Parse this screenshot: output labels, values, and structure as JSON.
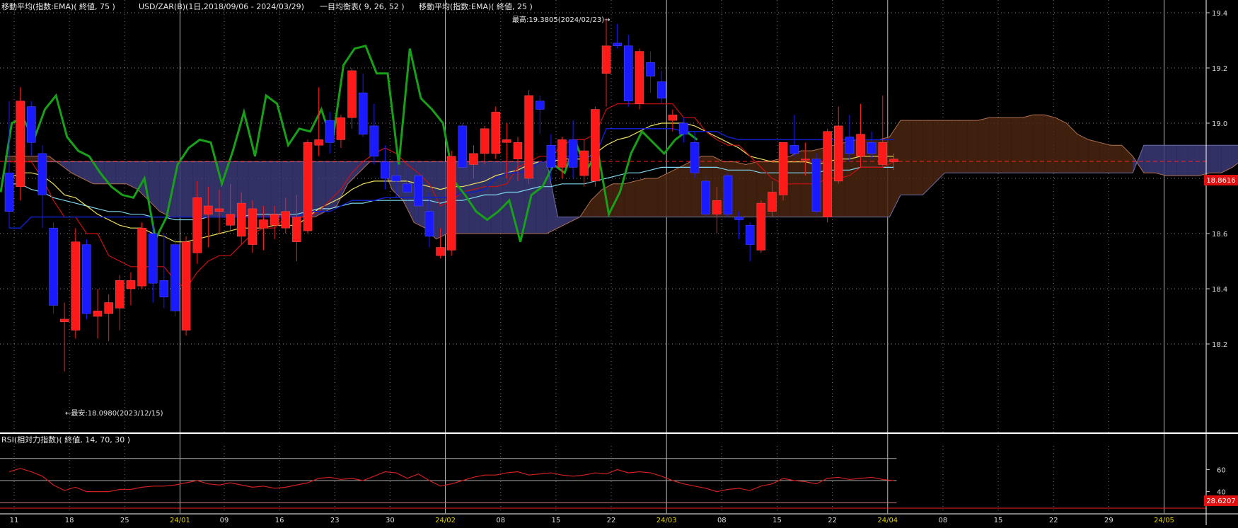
{
  "header": {
    "ema75_label": "移動平均(指数:EMA)( 終値, 75 )",
    "symbol_label": "USD/ZAR(B)(1日,2018/09/06 - 2024/03/29)",
    "ichimoku_label": "一目均衡表( 9, 26, 52 )",
    "ema25_label": "移動平均(指数:EMA)( 終値, 25 )"
  },
  "annotations": {
    "high": "最高:19.3805(2024/02/23)→",
    "low": "←最安:18.0980(2023/12/15)",
    "last_price": "18.8616",
    "rsi_last": "28.6207"
  },
  "rsi_panel": {
    "title": "RSI(相対力指数)( 終値, 14, 70, 30 )",
    "y_ticks": [
      "60",
      "40"
    ]
  },
  "colors": {
    "up_candle": "#ff1a1a",
    "down_candle": "#1a1aff",
    "ema75": "#7fd8f0",
    "ema25": "#f0e060",
    "tenkan": "#cc1010",
    "kijun": "#1020c8",
    "chikou": "#18a018",
    "kumo_bull": "#3a3a78",
    "kumo_bear": "#4a2410",
    "rsi_line": "#d02020",
    "price_line": "#ff2020"
  },
  "chart_data": [
    {
      "type": "candlestick",
      "ylim": [
        18.0,
        19.45
      ],
      "y_ticks": [
        "19.4",
        "19.2",
        "19.0",
        "18.8",
        "18.6",
        "18.4",
        "18.2"
      ],
      "x_ticks": [
        "11",
        "18",
        "25",
        "24/01",
        "09",
        "16",
        "23",
        "30",
        "24/02",
        "08",
        "15",
        "22",
        "24/03",
        "08",
        "15",
        "22",
        "24/04",
        "08",
        "15",
        "22",
        "29",
        "24/05"
      ],
      "bars": [
        [
          18.82,
          19.08,
          18.62,
          18.68
        ],
        [
          18.77,
          19.13,
          18.72,
          19.08
        ],
        [
          19.06,
          19.08,
          18.88,
          18.93
        ],
        [
          18.89,
          18.92,
          18.62,
          18.74
        ],
        [
          18.62,
          18.64,
          18.31,
          18.34
        ],
        [
          18.28,
          18.35,
          18.1,
          18.29
        ],
        [
          18.25,
          18.62,
          18.22,
          18.57
        ],
        [
          18.56,
          18.58,
          18.29,
          18.31
        ],
        [
          18.3,
          18.4,
          18.22,
          18.32
        ],
        [
          18.31,
          18.38,
          18.21,
          18.35
        ],
        [
          18.33,
          18.45,
          18.25,
          18.43
        ],
        [
          18.4,
          18.46,
          18.34,
          18.43
        ],
        [
          18.41,
          18.64,
          18.4,
          18.62
        ],
        [
          18.6,
          18.63,
          18.35,
          18.42
        ],
        [
          18.43,
          18.6,
          18.33,
          18.37
        ],
        [
          18.56,
          18.58,
          18.3,
          18.32
        ],
        [
          18.25,
          18.59,
          18.23,
          18.57
        ],
        [
          18.53,
          18.79,
          18.49,
          18.73
        ],
        [
          18.67,
          18.77,
          18.55,
          18.7
        ],
        [
          18.68,
          18.76,
          18.6,
          18.69
        ],
        [
          18.63,
          18.78,
          18.61,
          18.67
        ],
        [
          18.59,
          18.75,
          18.56,
          18.71
        ],
        [
          18.56,
          18.72,
          18.53,
          18.69
        ],
        [
          18.62,
          18.7,
          18.54,
          18.65
        ],
        [
          18.63,
          18.7,
          18.58,
          18.67
        ],
        [
          18.62,
          18.73,
          18.6,
          18.68
        ],
        [
          18.57,
          18.74,
          18.5,
          18.66
        ],
        [
          18.61,
          18.94,
          18.6,
          18.93
        ],
        [
          18.92,
          19.13,
          18.88,
          18.94
        ],
        [
          19.01,
          19.04,
          18.89,
          18.93
        ],
        [
          18.94,
          19.03,
          18.91,
          19.02
        ],
        [
          19.02,
          19.2,
          18.98,
          19.19
        ],
        [
          19.11,
          19.18,
          18.95,
          18.96
        ],
        [
          18.99,
          19.07,
          18.85,
          18.88
        ],
        [
          18.86,
          18.92,
          18.76,
          18.8
        ],
        [
          18.81,
          18.86,
          18.73,
          18.79
        ],
        [
          18.78,
          18.84,
          18.72,
          18.75
        ],
        [
          18.81,
          18.83,
          18.64,
          18.7
        ],
        [
          18.68,
          18.75,
          18.55,
          18.59
        ],
        [
          18.52,
          18.62,
          18.51,
          18.55
        ],
        [
          18.54,
          18.9,
          18.52,
          18.88
        ],
        [
          18.99,
          19.0,
          18.83,
          18.84
        ],
        [
          18.85,
          18.92,
          18.8,
          18.89
        ],
        [
          18.89,
          18.99,
          18.85,
          18.98
        ],
        [
          18.89,
          19.06,
          18.87,
          19.04
        ],
        [
          18.93,
          19.0,
          18.8,
          18.94
        ],
        [
          18.87,
          18.95,
          18.79,
          18.93
        ],
        [
          18.8,
          19.12,
          18.78,
          19.1
        ],
        [
          19.08,
          19.1,
          18.96,
          19.05
        ],
        [
          18.92,
          18.96,
          18.79,
          18.84
        ],
        [
          18.84,
          18.95,
          18.8,
          18.94
        ],
        [
          18.94,
          19.01,
          18.8,
          18.84
        ],
        [
          18.81,
          18.94,
          18.77,
          18.9
        ],
        [
          18.79,
          19.06,
          18.77,
          19.05
        ],
        [
          19.18,
          19.38,
          19.06,
          19.28
        ],
        [
          19.29,
          19.36,
          19.27,
          19.28
        ],
        [
          19.28,
          19.32,
          19.06,
          19.08
        ],
        [
          19.07,
          19.27,
          19.05,
          19.26
        ],
        [
          19.22,
          19.26,
          19.11,
          19.17
        ],
        [
          19.15,
          19.19,
          19.07,
          19.09
        ],
        [
          19.01,
          19.05,
          18.97,
          19.03
        ],
        [
          19.0,
          19.02,
          18.93,
          18.96
        ],
        [
          18.93,
          18.97,
          18.8,
          18.82
        ],
        [
          18.79,
          18.81,
          18.66,
          18.67
        ],
        [
          18.67,
          18.77,
          18.6,
          18.72
        ],
        [
          18.81,
          18.82,
          18.66,
          18.67
        ],
        [
          18.66,
          18.68,
          18.58,
          18.65
        ],
        [
          18.63,
          18.64,
          18.5,
          18.56
        ],
        [
          18.54,
          18.72,
          18.53,
          18.71
        ],
        [
          18.68,
          18.79,
          18.66,
          18.75
        ],
        [
          18.74,
          18.93,
          18.72,
          18.93
        ],
        [
          18.92,
          19.03,
          18.88,
          18.89
        ],
        [
          18.87,
          18.93,
          18.81,
          18.87
        ],
        [
          18.87,
          18.89,
          18.67,
          18.68
        ],
        [
          18.66,
          18.98,
          18.64,
          18.97
        ],
        [
          18.79,
          19.06,
          18.78,
          18.99
        ],
        [
          18.95,
          19.03,
          18.86,
          18.89
        ],
        [
          18.88,
          19.07,
          18.84,
          18.96
        ],
        [
          18.93,
          18.97,
          18.87,
          18.89
        ],
        [
          18.85,
          19.1,
          18.84,
          18.93
        ],
        [
          18.86,
          18.89,
          18.83,
          18.87
        ]
      ],
      "kumo_span_a": [
        18.88,
        18.88,
        18.88,
        18.88,
        18.88,
        18.85,
        18.82,
        18.8,
        18.78,
        18.78,
        18.78,
        18.78,
        18.76,
        18.72,
        18.68,
        18.66,
        18.66,
        18.66,
        18.66,
        18.66,
        18.66,
        18.66,
        18.66,
        18.66,
        18.66,
        18.66,
        18.66,
        18.66,
        18.66,
        18.68,
        18.7,
        18.78,
        18.82,
        18.86,
        18.86,
        18.76,
        18.72,
        18.64,
        18.62,
        18.58,
        18.6,
        18.6,
        18.6,
        18.6,
        18.6,
        18.6,
        18.6,
        18.6,
        18.6,
        18.6,
        18.62,
        18.64,
        18.66,
        18.72,
        18.76,
        18.78,
        18.78,
        18.79,
        18.8,
        18.8,
        18.82,
        18.84,
        18.86,
        18.88,
        18.88,
        18.86,
        18.86,
        18.85,
        18.86,
        18.86,
        18.87,
        18.88,
        18.9,
        18.9,
        18.91,
        18.92,
        18.93,
        18.94,
        18.94,
        18.94,
        18.95,
        19.01,
        19.01,
        19.01,
        19.01,
        19.01,
        19.01,
        19.01,
        19.01,
        19.02,
        19.02,
        19.02,
        19.02,
        19.03,
        19.03,
        19.02,
        19.0,
        18.96,
        18.94,
        18.93,
        18.92,
        18.92,
        18.88,
        18.82,
        18.82,
        18.81,
        18.81,
        18.81,
        18.81,
        18.82,
        18.82,
        18.84,
        18.87,
        18.89,
        18.9,
        18.9
      ],
      "kumo_span_b": [
        18.86,
        18.86,
        18.86,
        18.86,
        18.86,
        18.86,
        18.86,
        18.86,
        18.86,
        18.86,
        18.86,
        18.86,
        18.86,
        18.86,
        18.86,
        18.86,
        18.86,
        18.86,
        18.86,
        18.86,
        18.86,
        18.86,
        18.86,
        18.86,
        18.86,
        18.86,
        18.86,
        18.86,
        18.86,
        18.86,
        18.86,
        18.86,
        18.86,
        18.86,
        18.86,
        18.86,
        18.86,
        18.86,
        18.86,
        18.86,
        18.86,
        18.86,
        18.86,
        18.86,
        18.86,
        18.86,
        18.86,
        18.86,
        18.86,
        18.86,
        18.66,
        18.66,
        18.66,
        18.66,
        18.66,
        18.66,
        18.66,
        18.66,
        18.66,
        18.66,
        18.66,
        18.66,
        18.66,
        18.66,
        18.66,
        18.66,
        18.66,
        18.66,
        18.66,
        18.66,
        18.66,
        18.66,
        18.66,
        18.66,
        18.66,
        18.66,
        18.66,
        18.66,
        18.66,
        18.66,
        18.66,
        18.74,
        18.74,
        18.74,
        18.78,
        18.82,
        18.82,
        18.82,
        18.82,
        18.82,
        18.82,
        18.82,
        18.82,
        18.82,
        18.82,
        18.82,
        18.82,
        18.82,
        18.82,
        18.82,
        18.82,
        18.82,
        18.82,
        18.92,
        18.92,
        18.92,
        18.92,
        18.92,
        18.92,
        18.92,
        18.92,
        18.92,
        18.92,
        18.92,
        18.92,
        18.92
      ],
      "ema75": [
        18.78,
        18.78,
        18.76,
        18.75,
        18.73,
        18.72,
        18.71,
        18.7,
        18.69,
        18.68,
        18.68,
        18.67,
        18.67,
        18.66,
        18.66,
        18.65,
        18.65,
        18.65,
        18.66,
        18.66,
        18.66,
        18.66,
        18.67,
        18.67,
        18.67,
        18.67,
        18.67,
        18.68,
        18.69,
        18.69,
        18.7,
        18.71,
        18.71,
        18.72,
        18.72,
        18.72,
        18.72,
        18.72,
        18.72,
        18.71,
        18.72,
        18.72,
        18.73,
        18.74,
        18.74,
        18.75,
        18.75,
        18.76,
        18.77,
        18.77,
        18.78,
        18.78,
        18.78,
        18.79,
        18.8,
        18.81,
        18.82,
        18.82,
        18.83,
        18.84,
        18.84,
        18.84,
        18.84,
        18.84,
        18.84,
        18.83,
        18.83,
        18.83,
        18.82,
        18.82,
        18.82,
        18.82,
        18.82,
        18.82,
        18.83,
        18.83,
        18.83,
        18.84,
        18.84,
        18.84,
        18.84
      ],
      "ema25": [
        18.8,
        18.82,
        18.82,
        18.81,
        18.78,
        18.74,
        18.73,
        18.7,
        18.67,
        18.65,
        18.63,
        18.62,
        18.62,
        18.6,
        18.59,
        18.57,
        18.57,
        18.58,
        18.59,
        18.6,
        18.61,
        18.62,
        18.62,
        18.62,
        18.63,
        18.63,
        18.63,
        18.66,
        18.69,
        18.71,
        18.73,
        18.76,
        18.78,
        18.79,
        18.79,
        18.79,
        18.79,
        18.78,
        18.77,
        18.76,
        18.77,
        18.77,
        18.78,
        18.79,
        18.81,
        18.82,
        18.83,
        18.85,
        18.86,
        18.86,
        18.87,
        18.87,
        18.87,
        18.89,
        18.92,
        18.94,
        18.95,
        18.97,
        18.99,
        19.0,
        19.0,
        19.0,
        18.99,
        18.97,
        18.95,
        18.93,
        18.91,
        18.88,
        18.87,
        18.86,
        18.86,
        18.86,
        18.86,
        18.85,
        18.86,
        18.87,
        18.87,
        18.88,
        18.88,
        18.88,
        18.88
      ],
      "tenkan": [
        18.86,
        18.86,
        18.86,
        18.8,
        18.72,
        18.66,
        18.66,
        18.6,
        18.6,
        18.52,
        18.5,
        18.48,
        18.48,
        18.48,
        18.48,
        18.43,
        18.4,
        18.46,
        18.5,
        18.52,
        18.52,
        18.56,
        18.6,
        18.62,
        18.62,
        18.66,
        18.66,
        18.66,
        18.68,
        18.72,
        18.76,
        18.82,
        18.86,
        18.89,
        18.91,
        18.89,
        18.85,
        18.82,
        18.78,
        18.7,
        18.72,
        18.75,
        18.76,
        18.77,
        18.77,
        18.78,
        18.84,
        18.86,
        18.88,
        18.88,
        18.92,
        18.94,
        18.94,
        18.96,
        19.05,
        19.07,
        19.07,
        19.07,
        19.07,
        19.07,
        19.07,
        19.02,
        19.02,
        18.97,
        18.94,
        18.92,
        18.92,
        18.88,
        18.84,
        18.8,
        18.78,
        18.78,
        18.78,
        18.78,
        18.8,
        18.8,
        18.81,
        18.84,
        18.84,
        18.84,
        18.86
      ],
      "kijun": [
        18.62,
        18.62,
        18.66,
        18.66,
        18.66,
        18.66,
        18.66,
        18.66,
        18.66,
        18.66,
        18.66,
        18.66,
        18.66,
        18.66,
        18.66,
        18.66,
        18.66,
        18.66,
        18.66,
        18.66,
        18.66,
        18.66,
        18.66,
        18.66,
        18.66,
        18.66,
        18.66,
        18.68,
        18.68,
        18.68,
        18.7,
        18.72,
        18.72,
        18.72,
        18.73,
        18.73,
        18.73,
        18.73,
        18.73,
        18.73,
        18.73,
        18.75,
        18.75,
        18.76,
        18.8,
        18.82,
        18.82,
        18.83,
        18.86,
        18.86,
        18.88,
        18.88,
        18.88,
        18.88,
        18.98,
        18.98,
        18.98,
        18.98,
        18.98,
        18.98,
        18.98,
        18.97,
        18.97,
        18.97,
        18.97,
        18.95,
        18.94,
        18.94,
        18.94,
        18.94,
        18.94,
        18.94,
        18.94,
        18.94,
        18.94,
        18.94,
        18.94,
        18.94,
        18.94,
        18.94,
        18.94
      ],
      "chikou": [
        18.75,
        19.0,
        19.02,
        18.94,
        19.05,
        19.1,
        18.95,
        18.9,
        18.88,
        18.82,
        18.77,
        18.74,
        18.73,
        18.8,
        18.58,
        18.66,
        18.85,
        18.91,
        18.94,
        18.93,
        18.78,
        18.9,
        19.04,
        18.88,
        19.1,
        19.07,
        18.92,
        18.98,
        18.97,
        19.05,
        18.93,
        19.21,
        19.27,
        19.28,
        19.18,
        19.18,
        18.85,
        19.27,
        19.09,
        19.05,
        19.0,
        18.79,
        18.74,
        18.68,
        18.65,
        18.68,
        18.72,
        18.57,
        18.74,
        18.77,
        18.85,
        18.82,
        18.93,
        18.83,
        18.9,
        18.67,
        18.75,
        18.89,
        18.97,
        18.93,
        18.89,
        18.94,
        18.97,
        18.94
      ],
      "price_line": 18.8616
    },
    {
      "type": "line",
      "title": "RSI(相対力指数)( 終値, 14, 70, 30 )",
      "ylim": [
        25,
        75
      ],
      "rsi": [
        58,
        61,
        58,
        54,
        46,
        41,
        44,
        40,
        40,
        40,
        42,
        42,
        44,
        45,
        45,
        46,
        48,
        50,
        47,
        46,
        48,
        46,
        44,
        45,
        43,
        44,
        46,
        48,
        52,
        53,
        51,
        52,
        50,
        54,
        58,
        57,
        52,
        56,
        50,
        45,
        47,
        50,
        53,
        55,
        55,
        57,
        58,
        55,
        56,
        57,
        55,
        54,
        55,
        57,
        56,
        60,
        57,
        58,
        57,
        54,
        50,
        47,
        45,
        43,
        40,
        42,
        43,
        41,
        45,
        47,
        52,
        50,
        49,
        47,
        52,
        53,
        51,
        52,
        53,
        51,
        50
      ]
    }
  ]
}
